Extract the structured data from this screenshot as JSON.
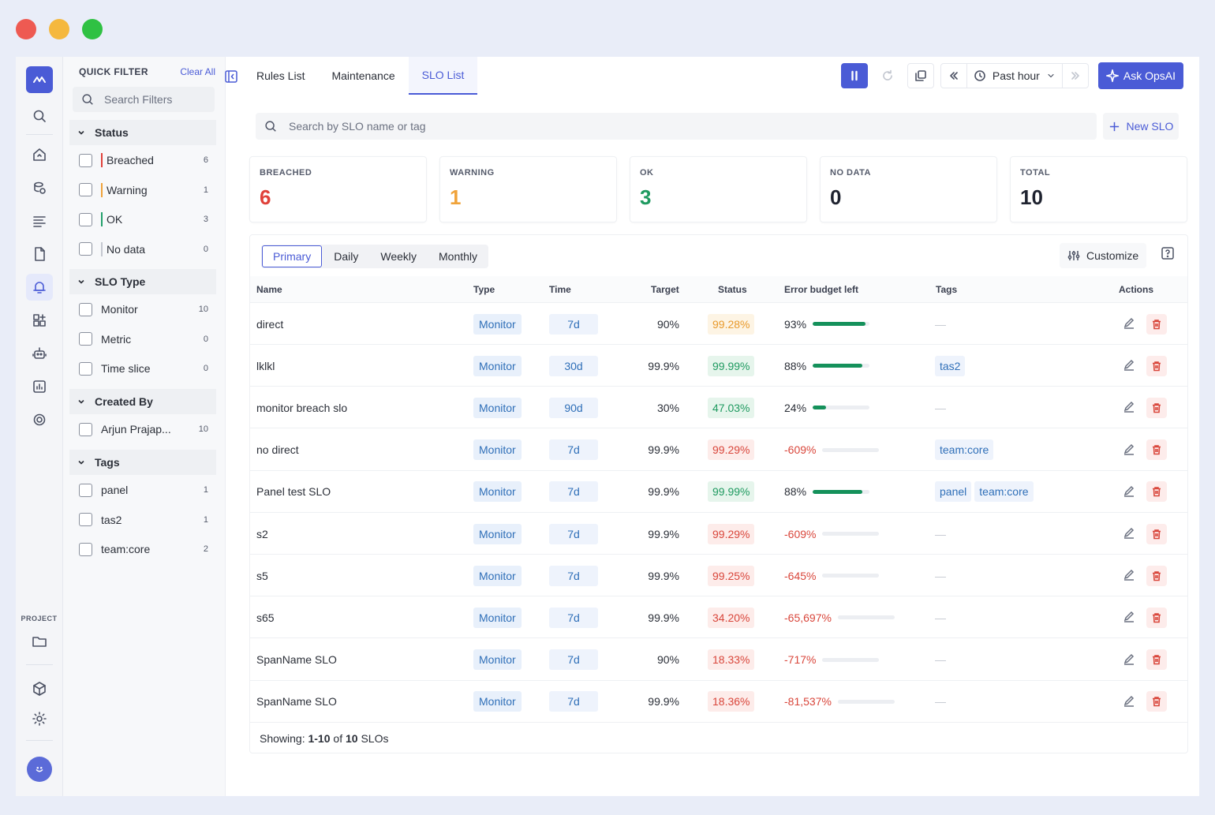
{
  "window_controls": {
    "close_color": "#ee5a52",
    "minimize_color": "#f5b83e",
    "maximize_color": "#2fc143"
  },
  "rail": {
    "project_label": "PROJECT"
  },
  "quick_filter": {
    "title": "QUICK FILTER",
    "clear_all": "Clear All",
    "search_placeholder": "Search Filters",
    "sections": [
      {
        "title": "Status",
        "items": [
          {
            "label": "Breached",
            "count": "6",
            "color": "#e0413a"
          },
          {
            "label": "Warning",
            "count": "1",
            "color": "#f0a33a"
          },
          {
            "label": "OK",
            "count": "3",
            "color": "#22a06b"
          },
          {
            "label": "No data",
            "count": "0",
            "color": "#c4c8d0"
          }
        ]
      },
      {
        "title": "SLO Type",
        "items": [
          {
            "label": "Monitor",
            "count": "10"
          },
          {
            "label": "Metric",
            "count": "0"
          },
          {
            "label": "Time slice",
            "count": "0"
          }
        ]
      },
      {
        "title": "Created By",
        "items": [
          {
            "label": "Arjun Prajap...",
            "count": "10"
          }
        ]
      },
      {
        "title": "Tags",
        "items": [
          {
            "label": "panel",
            "count": "1"
          },
          {
            "label": "tas2",
            "count": "1"
          },
          {
            "label": "team:core",
            "count": "2"
          }
        ]
      }
    ]
  },
  "tabs": [
    {
      "label": "Rules List",
      "active": false
    },
    {
      "label": "Maintenance",
      "active": false
    },
    {
      "label": "SLO List",
      "active": true
    }
  ],
  "toolbar": {
    "time_range": "Past hour",
    "ask_label": "Ask OpsAI"
  },
  "slo_search": {
    "placeholder": "Search by SLO name or tag"
  },
  "new_slo_label": "New SLO",
  "summary": [
    {
      "label": "BREACHED",
      "value": "6",
      "color": "#e0413a"
    },
    {
      "label": "WARNING",
      "value": "1",
      "color": "#f0a33a"
    },
    {
      "label": "OK",
      "value": "3",
      "color": "#1f9a60"
    },
    {
      "label": "NO DATA",
      "value": "0",
      "color": "#1f2330"
    },
    {
      "label": "TOTAL",
      "value": "10",
      "color": "#1f2330"
    }
  ],
  "period_tabs": [
    {
      "label": "Primary",
      "active": true
    },
    {
      "label": "Daily",
      "active": false
    },
    {
      "label": "Weekly",
      "active": false
    },
    {
      "label": "Monthly",
      "active": false
    }
  ],
  "customize_label": "Customize",
  "columns": {
    "name": "Name",
    "type": "Type",
    "time": "Time",
    "target": "Target",
    "status": "Status",
    "budget": "Error budget left",
    "tags": "Tags",
    "actions": "Actions"
  },
  "rows": [
    {
      "name": "direct",
      "type": "Monitor",
      "time": "7d",
      "target": "90%",
      "status": "99.28%",
      "status_level": "warning",
      "budget": "93%",
      "budget_pct": 93,
      "budget_neg": false,
      "tags": []
    },
    {
      "name": "lklkl",
      "type": "Monitor",
      "time": "30d",
      "target": "99.9%",
      "status": "99.99%",
      "status_level": "ok",
      "budget": "88%",
      "budget_pct": 88,
      "budget_neg": false,
      "tags": [
        "tas2"
      ]
    },
    {
      "name": "monitor breach slo",
      "type": "Monitor",
      "time": "90d",
      "target": "30%",
      "status": "47.03%",
      "status_level": "ok",
      "budget": "24%",
      "budget_pct": 24,
      "budget_neg": false,
      "tags": []
    },
    {
      "name": "no direct",
      "type": "Monitor",
      "time": "7d",
      "target": "99.9%",
      "status": "99.29%",
      "status_level": "breached",
      "budget": "-609%",
      "budget_pct": 0,
      "budget_neg": true,
      "tags": [
        "team:core"
      ]
    },
    {
      "name": "Panel test SLO",
      "type": "Monitor",
      "time": "7d",
      "target": "99.9%",
      "status": "99.99%",
      "status_level": "ok",
      "budget": "88%",
      "budget_pct": 88,
      "budget_neg": false,
      "tags": [
        "panel",
        "team:core"
      ]
    },
    {
      "name": "s2",
      "type": "Monitor",
      "time": "7d",
      "target": "99.9%",
      "status": "99.29%",
      "status_level": "breached",
      "budget": "-609%",
      "budget_pct": 0,
      "budget_neg": true,
      "tags": []
    },
    {
      "name": "s5",
      "type": "Monitor",
      "time": "7d",
      "target": "99.9%",
      "status": "99.25%",
      "status_level": "breached",
      "budget": "-645%",
      "budget_pct": 0,
      "budget_neg": true,
      "tags": []
    },
    {
      "name": "s65",
      "type": "Monitor",
      "time": "7d",
      "target": "99.9%",
      "status": "34.20%",
      "status_level": "breached",
      "budget": "-65,697%",
      "budget_pct": 0,
      "budget_neg": true,
      "tags": []
    },
    {
      "name": "SpanName SLO",
      "type": "Monitor",
      "time": "7d",
      "target": "90%",
      "status": "18.33%",
      "status_level": "breached",
      "budget": "-717%",
      "budget_pct": 0,
      "budget_neg": true,
      "tags": []
    },
    {
      "name": "SpanName SLO",
      "type": "Monitor",
      "time": "7d",
      "target": "99.9%",
      "status": "18.36%",
      "status_level": "breached",
      "budget": "-81,537%",
      "budget_pct": 0,
      "budget_neg": true,
      "tags": []
    }
  ],
  "footer": {
    "prefix": "Showing: ",
    "range": "1-10",
    "of": " of ",
    "total": "10",
    "suffix": " SLOs"
  },
  "empty_tag": "—",
  "colors": {
    "accent": "#4a5bd6",
    "ok": "#1f9a60",
    "warning": "#e99a2c",
    "breached": "#d9463b"
  }
}
